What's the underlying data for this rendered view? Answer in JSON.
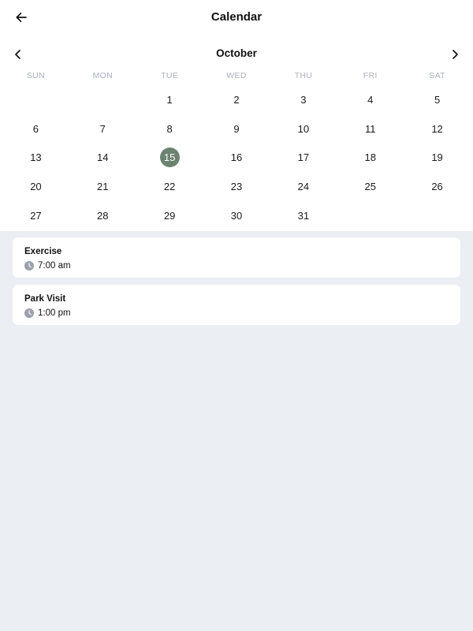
{
  "header": {
    "title": "Calendar",
    "back_icon": "arrow-left-icon"
  },
  "calendar": {
    "month": "October",
    "prev_icon": "chevron-left-icon",
    "next_icon": "chevron-right-icon",
    "weekdays": [
      "SUN",
      "MON",
      "TUE",
      "WED",
      "THU",
      "FRI",
      "SAT"
    ],
    "days": [
      "",
      "",
      "1",
      "2",
      "3",
      "4",
      "5",
      "6",
      "7",
      "8",
      "9",
      "10",
      "11",
      "12",
      "13",
      "14",
      "15",
      "16",
      "17",
      "18",
      "19",
      "20",
      "21",
      "22",
      "23",
      "24",
      "25",
      "26",
      "27",
      "28",
      "29",
      "30",
      "31",
      "",
      ""
    ],
    "selected_day": "15",
    "selected_color": "#6b8370"
  },
  "events": [
    {
      "title": "Exercise",
      "time": "7:00 am",
      "icon": "clock-icon"
    },
    {
      "title": "Park Visit",
      "time": "1:00 pm",
      "icon": "clock-icon"
    }
  ]
}
